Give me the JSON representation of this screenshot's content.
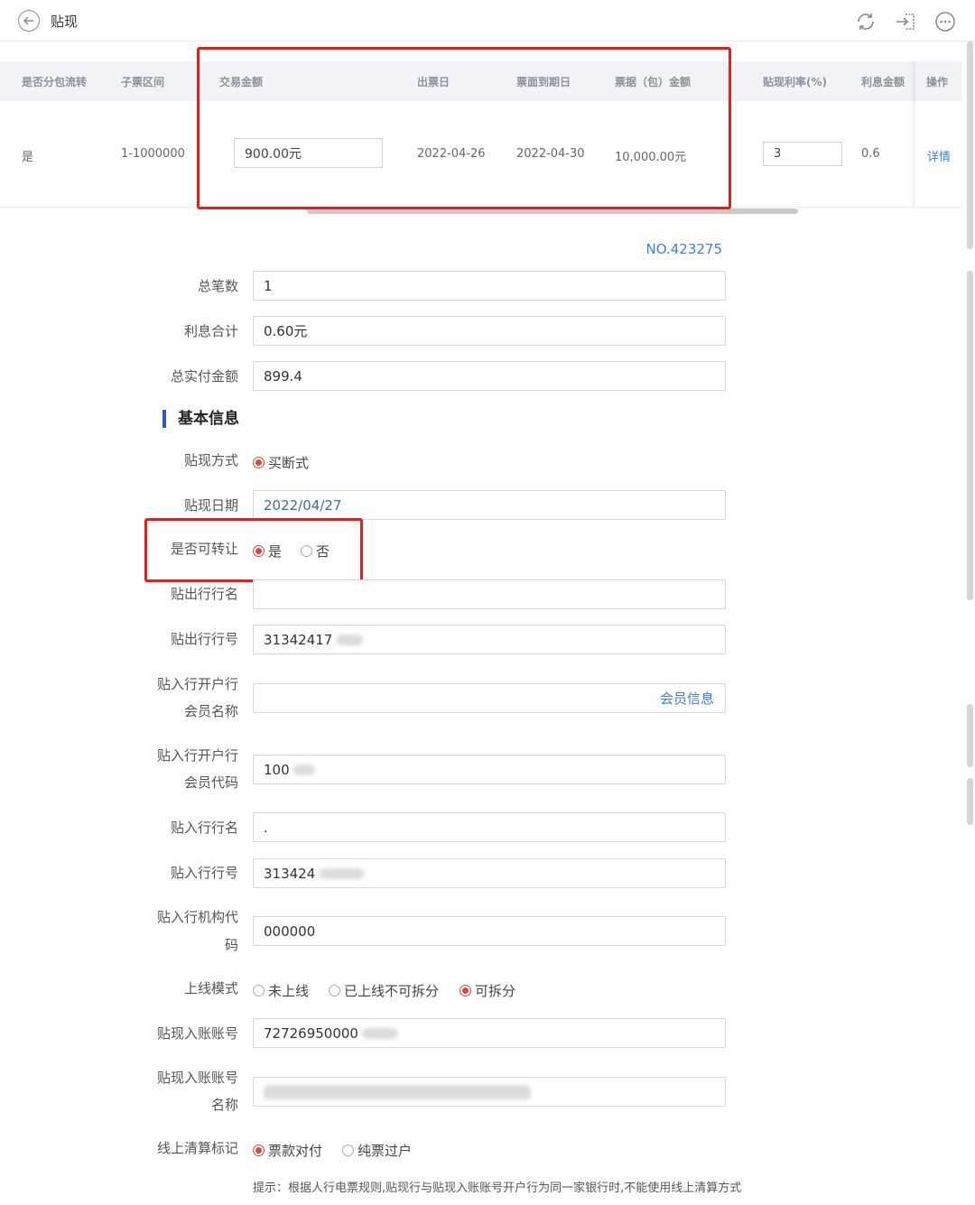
{
  "header": {
    "title": "贴现",
    "icons": [
      "back-arrow-icon",
      "refresh-icon",
      "enter-icon",
      "more-icon"
    ]
  },
  "table": {
    "columns": [
      "是否分包流转",
      "子票区间",
      "交易金额",
      "出票日",
      "票面到期日",
      "票据（包）金额",
      "贴现利率(%)",
      "利息金额",
      "操作"
    ],
    "row": {
      "split": "是",
      "range": "1-1000000",
      "amount": "900.00元",
      "issue_date": "2022-04-26",
      "due_date": "2022-04-30",
      "bill_amount": "10,000.00元",
      "rate": "3",
      "interest": "0.6",
      "action": "详情"
    }
  },
  "form": {
    "no": "NO.423275",
    "total_count_label": "总笔数",
    "total_count": "1",
    "interest_total_label": "利息合计",
    "interest_total": "0.60元",
    "total_paid_label": "总实付金额",
    "total_paid": "899.4",
    "section_title": "基本信息",
    "method_label": "贴现方式",
    "method_option": "买断式",
    "date_label": "贴现日期",
    "date": "2022/04/27",
    "transfer_label": "是否可转让",
    "transfer_yes": "是",
    "transfer_no": "否",
    "out_bank_name_label": "贴出行行名",
    "out_bank_name": "",
    "out_bank_no_label": "贴出行行号",
    "out_bank_no": "31342417",
    "in_member_name_label_1": "贴入行开户行",
    "in_member_name_label_2": "会员名称",
    "in_member_name": "",
    "member_info_link": "会员信息",
    "in_member_code_label_1": "贴入行开户行",
    "in_member_code_label_2": "会员代码",
    "in_member_code": "100",
    "in_bank_name_label": "贴入行行名",
    "in_bank_name": ".",
    "in_bank_no_label": "贴入行行号",
    "in_bank_no": "313424",
    "in_org_code_label_1": "贴入行机构代",
    "in_org_code_label_2": "码",
    "in_org_code": "000000",
    "online_mode_label": "上线模式",
    "online_opt_1": "未上线",
    "online_opt_2": "已上线不可拆分",
    "online_opt_3": "可拆分",
    "account_no_label": "贴现入账账号",
    "account_no": "72726950000",
    "account_name_label_1": "贴现入账账号",
    "account_name_label_2": "名称",
    "clearing_label": "线上清算标记",
    "clearing_opt_1": "票款对付",
    "clearing_opt_2": "纯票过户",
    "hint": "提示：根据人行电票规则,贴现行与贴现入账账号开户行为同一家银行时,不能使用线上清算方式"
  },
  "colors": {
    "accent_blue": "#3d7ede",
    "radio_red": "#e0453a",
    "highlight_red": "#e0201c",
    "section_bar": "#3355cc"
  }
}
